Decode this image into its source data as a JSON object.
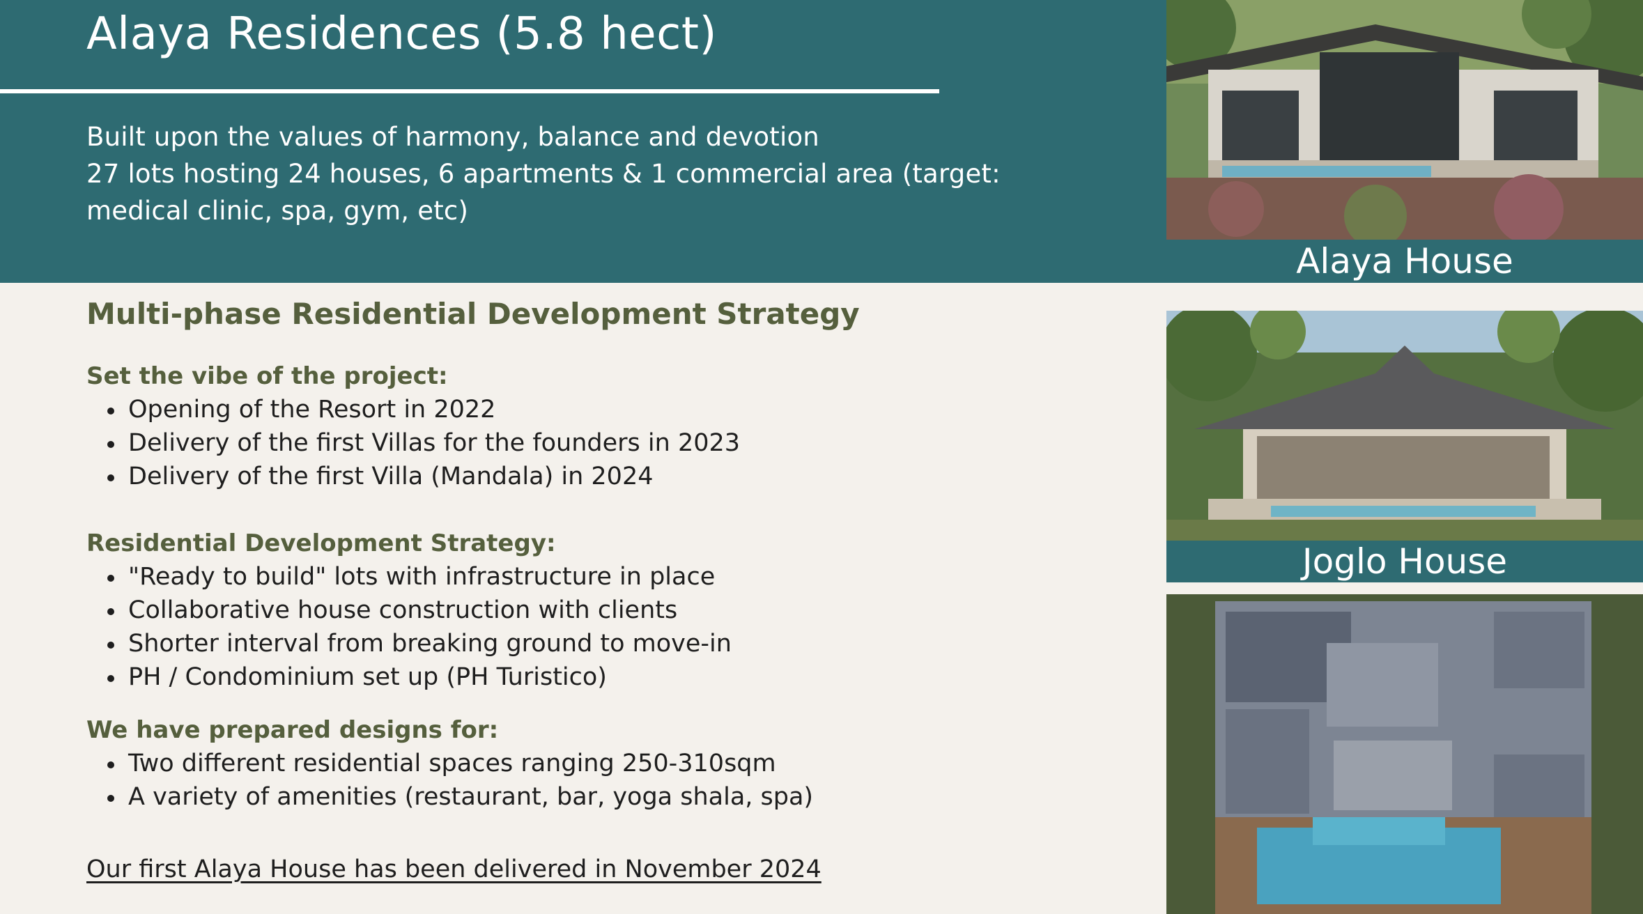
{
  "header": {
    "title": "Alaya Residences (5.8 hect)",
    "intro_line_1": "Built upon the values of harmony, balance and devotion",
    "intro_line_2": "27 lots hosting 24 houses, 6 apartments & 1 commercial area (target: medical clinic, spa, gym, etc)"
  },
  "content": {
    "section_title": "Multi-phase Residential Development Strategy",
    "groups": [
      {
        "heading": "Set the vibe of the project:",
        "items": [
          "Opening of the Resort in 2022",
          "Delivery of the first Villas for the founders in 2023",
          "Delivery of the first Villa (Mandala) in 2024"
        ]
      },
      {
        "heading": "Residential Development Strategy:",
        "items": [
          "\"Ready to build\" lots with infrastructure in place",
          "Collaborative house construction with clients",
          "Shorter interval from breaking ground to move-in",
          "PH / Condominium set up (PH Turistico)"
        ]
      },
      {
        "heading": "We have prepared designs for:",
        "items": [
          "Two different residential spaces ranging 250-310sqm",
          "A variety of amenities (restaurant, bar, yoga shala, spa)"
        ]
      }
    ],
    "closing": "Our first Alaya House has been delivered in November 2024"
  },
  "images": {
    "alaya_caption": "Alaya House",
    "joglo_caption": "Joglo House"
  },
  "colors": {
    "header_teal": "#2e6b72",
    "heading_olive": "#555f3d",
    "background": "#f4f1ec"
  }
}
